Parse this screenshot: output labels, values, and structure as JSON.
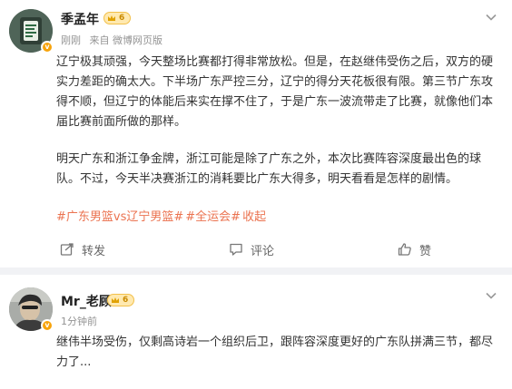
{
  "posts": [
    {
      "author": "季孟年",
      "level": "6",
      "meta": {
        "time": "刚刚",
        "source": "来自 微博网页版"
      },
      "paragraphs": [
        "辽宁极其顽强，今天整场比赛都打得非常放松。但是，在赵继伟受伤之后，双方的硬实力差距的确太大。下半场广东严控三分，辽宁的得分天花板很有限。第三节广东攻得不顺，但辽宁的体能后来实在撑不住了，于是广东一波流带走了比赛，就像他们本届比赛前面所做的那样。",
        "明天广东和浙江争金牌，浙江可能是除了广东之外，本次比赛阵容深度最出色的球队。不过，今天半决赛浙江的消耗要比广东大得多，明天看看是怎样的剧情。"
      ],
      "tags": [
        "#广东男篮vs辽宁男篮#",
        "#全运会#",
        "收起"
      ],
      "actions": {
        "repost": "转发",
        "comment": "评论",
        "like": "赞"
      }
    },
    {
      "author": "Mr_老顾",
      "level": "6",
      "meta": {
        "time": "1分钟前"
      },
      "paragraphs": [
        "继伟半场受伤，仅剩高诗岩一个组织后卫，跟阵容深度更好的广东队拼满三节，都尽力了..."
      ]
    }
  ],
  "colors": {
    "accent": "#eb7350",
    "badge": "#f7a30b",
    "meta": "#939393"
  }
}
